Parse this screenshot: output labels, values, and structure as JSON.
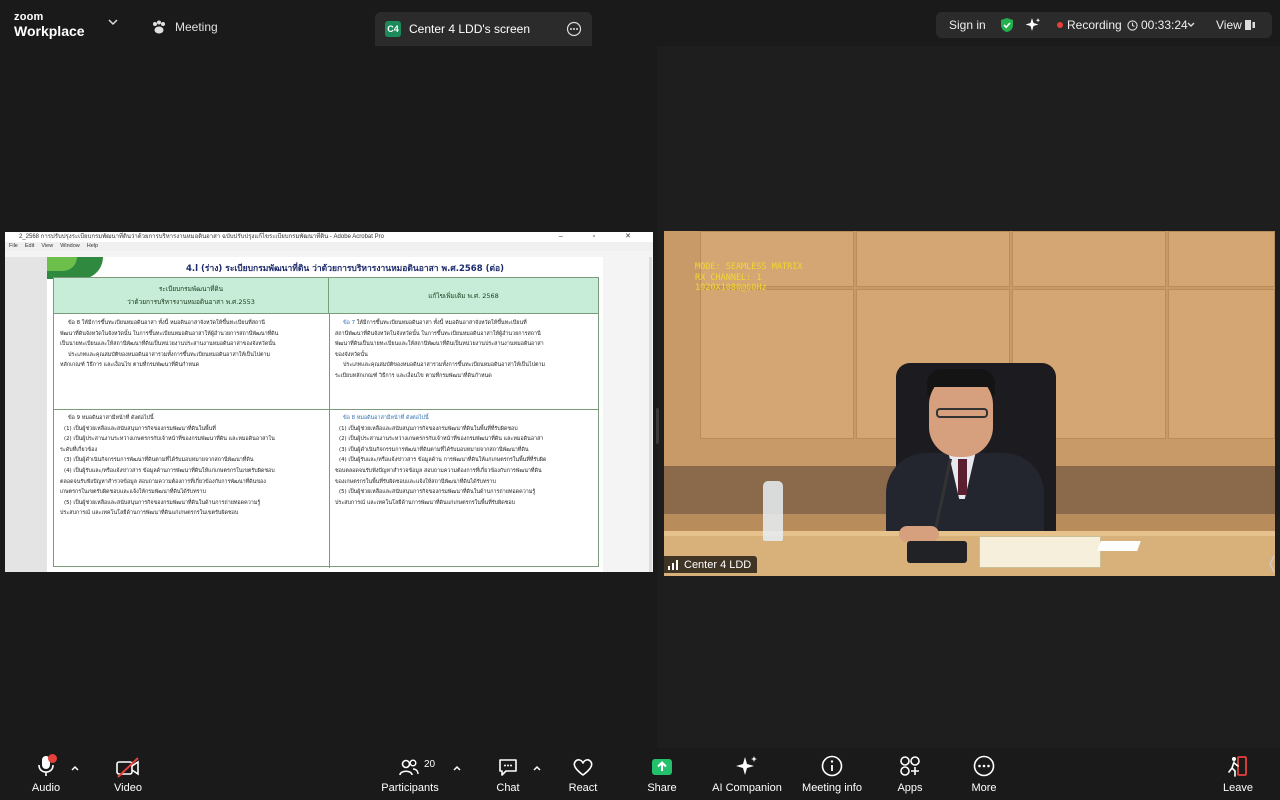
{
  "app": {
    "brand_line1": "zoom",
    "brand_line2": "Workplace"
  },
  "topbar": {
    "meeting_label": "Meeting",
    "share_badge": "C4",
    "share_label": "Center 4 LDD's screen",
    "signin_label": "Sign in",
    "recording_label": "Recording",
    "timer": "00:33:24",
    "view_label": "View"
  },
  "colors": {
    "background": "#1a1a1a",
    "recording_red": "#e5403a",
    "share_green": "#1d8a5b",
    "shield_green": "#22b14c"
  },
  "document": {
    "window_title": "2_2568 การปรับปรุงระเบียบกรมพัฒนาที่ดินว่าด้วยการบริหารงานหมอดินอาสา ฉบับปรับปรุงแก้ไขระเบียบกรมพัฒนาที่ดิน - Adobe Acrobat Pro",
    "window_buttons": "– ▫ ✕",
    "menu": [
      "File",
      "Edit",
      "View",
      "Window",
      "Help"
    ],
    "heading": "4.l (ร่าง) ระเบียบกรมพัฒนาที่ดิน ว่าด้วยการบริหารงานหมอดินอาสา พ.ศ.2568 (ต่อ)",
    "col_left_line1": "ระเบียบกรมพัฒนาที่ดิน",
    "col_left_line2": "ว่าด้วยการบริหารงานหมอดินอาสา พ.ศ.2553",
    "col_right": "แก้ไขเพิ่มเติม พ.ศ. 2568",
    "row1_left": [
      "ข้อ 8 ให้มีการขึ้นทะเบียนหมอดินอาสา ทั้งนี้ หมอดินอาสาจังหวัดให้ขึ้นทะเบียนที่สถานี",
      "พัฒนาที่ดินจังหวัดในจังหวัดนั้น ในการขึ้นทะเบียนหมอดินอาสาให้ผู้อำนวยการสถานีพัฒนาที่ดิน",
      "เป็นนายทะเบียนและให้สถานีพัฒนาที่ดินเป็นหน่วยงานประสานงานหมอดินอาสาของจังหวัดนั้น",
      "ประเภทและคุณสมบัติของหมอดินอาสารวมทั้งการขึ้นทะเบียนหมอดินอาสาให้เป็นไปตาม",
      "หลักเกณฑ์ วิธีการ และเงื่อนไข ตามที่กรมพัฒนาที่ดินกำหนด"
    ],
    "row1_right_prefix": "ข้อ 7",
    "row1_right": [
      " ให้มีการขึ้นทะเบียนหมอดินอาสา ทั้งนี้ หมอดินอาสาจังหวัดให้ขึ้นทะเบียนที่",
      "สถานีพัฒนาที่ดินจังหวัดในจังหวัดนั้น ในการขึ้นทะเบียนหมอดินอาสาให้ผู้อำนวยการสถานี",
      "พัฒนาที่ดินเป็นนายทะเบียนและให้สถานีพัฒนาที่ดินเป็นหน่วยงานประสานงานหมอดินอาสา",
      "ของจังหวัดนั้น",
      "ประเภทและคุณสมบัติของหมอดินอาสารวมทั้งการขึ้นทะเบียนหมอดินอาสาให้เป็นไปตาม",
      "ระเบียบหลักเกณฑ์ วิธีการ และเงื่อนไข ตามที่กรมพัฒนาที่ดินกำหนด"
    ],
    "row2_left": [
      "ข้อ 9 หมอดินอาสามีหน้าที่ ดังต่อไปนี้",
      "(1) เป็นผู้ช่วยเหลือและสนับสนุนการกิจของกรมพัฒนาที่ดินในพื้นที่",
      "(2) เป็นผู้ประสานงานระหว่างเกษตรกรกับเจ้าหน้าที่ของกรมพัฒนาที่ดิน และหมอดินอาสาใน",
      "ระดับที่เกี่ยวข้อง",
      "(3) เป็นผู้ดำเนินกิจกรรมการพัฒนาที่ดินตามที่ได้รับมอบหมายจากสถานีพัฒนาที่ดิน",
      "(4) เป็นผู้รับและ/หรือแจ้งข่าวสาร ข้อมูลด้านการพัฒนาที่ดินให้แก่เกษตรกรในเขตรับผิดชอบ",
      "ตลอดจนรับฟังปัญหาสำรวจข้อมูล สอบถามความต้องการที่เกี่ยวข้องกับการพัฒนาที่ดินของ",
      "เกษตรกรในเขตรับผิดชอบและแจ้งให้กรมพัฒนาที่ดินได้รับทราบ",
      "(5) เป็นผู้ช่วยเหลือและสนับสนุนการกิจของกรมพัฒนาที่ดินในด้านการถ่ายทอดความรู้",
      "ประสบการณ์ และเทคโนโลยีด้านการพัฒนาที่ดินแก่เกษตรกรในเขตรับผิดชอบ"
    ],
    "row2_right": [
      "ข้อ 8 หมอดินอาสามีหน้าที่ ดังต่อไปนี้",
      "(1) เป็นผู้ช่วยเหลือและสนับสนุนการกิจของกรมพัฒนาที่ดินในพื้นที่ที่รับผิดชอบ",
      "(2) เป็นผู้ประสานงานระหว่างเกษตรกรกับเจ้าหน้าที่ของกรมพัฒนาที่ดิน และหมอดินอาสา",
      "(3) เป็นผู้ดำเนินกิจกรรมการพัฒนาที่ดินตามที่ได้รับมอบหมายจากสถานีพัฒนาที่ดิน",
      "(4) เป็นผู้รับและ/หรือแจ้งข่าวสาร ข้อมูลด้าน การพัฒนาที่ดินให้แก่เกษตรกรในพื้นที่ที่รับผิด",
      "ชอบตลอดจนรับฟังปัญหาสำรวจข้อมูล สอบถามความต้องการที่เกี่ยวข้องกับการพัฒนาที่ดิน",
      "ของเกษตรกรในพื้นที่รับผิดชอบและแจ้งให้สถานีพัฒนาที่ดินได้รับทราบ",
      "(5) เป็นผู้ช่วยเหลือและสนับสนุนการกิจของกรมพัฒนาที่ดินในด้านการถ่ายทอดความรู้",
      "ประสบการณ์ และเทคโนโลยีด้านการพัฒนาที่ดินแก่เกษตรกรในพื้นที่รับผิดชอบ"
    ]
  },
  "video": {
    "overlay_line1": "MODE: SEAMLESS MATRIX",
    "overlay_line2": "RX CHANNEL: 1",
    "overlay_line3": "1920X1080@60Hz",
    "participant_name": "Center 4 LDD"
  },
  "toolbar": {
    "audio": "Audio",
    "video": "Video",
    "participants": "Participants",
    "participants_count": "20",
    "chat": "Chat",
    "react": "React",
    "share": "Share",
    "ai_companion": "AI Companion",
    "meeting_info": "Meeting info",
    "apps": "Apps",
    "more": "More",
    "leave": "Leave"
  },
  "icons": {
    "audio": "microphone-icon",
    "video": "video-off-icon",
    "participants": "people-icon",
    "chat": "chat-icon",
    "react": "heart-icon",
    "share": "share-screen-icon",
    "ai_companion": "sparkle-icon",
    "meeting_info": "info-icon",
    "apps": "apps-icon",
    "more": "more-icon",
    "leave": "leave-icon"
  }
}
